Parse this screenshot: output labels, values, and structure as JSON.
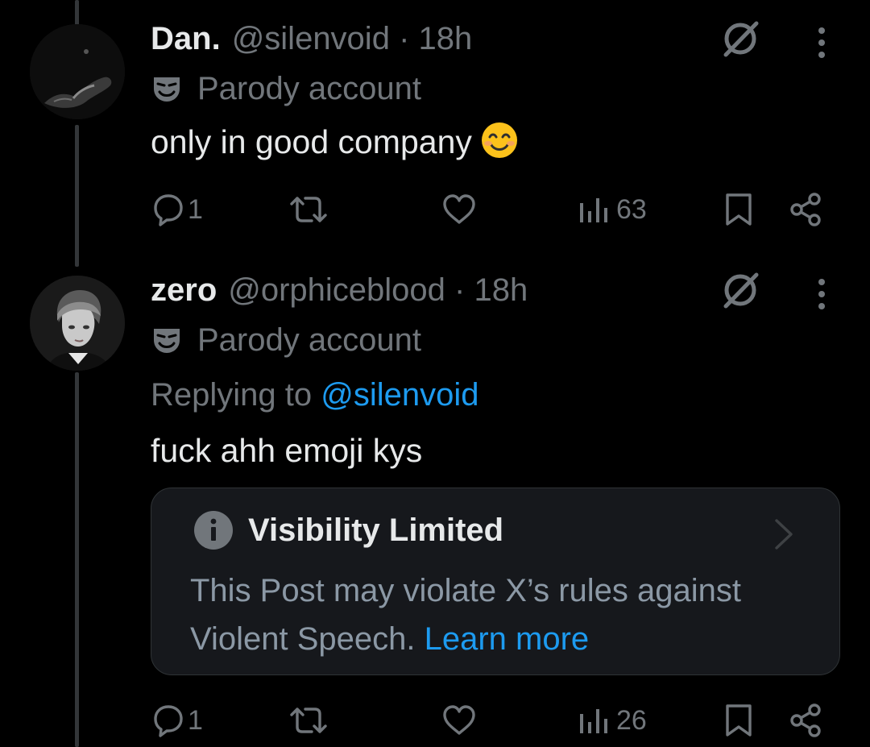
{
  "posts": [
    {
      "display_name": "Dan.",
      "handle": "@silenvoid",
      "time": "· 18h",
      "label": "Parody account",
      "text": "only in good company",
      "replies": "1",
      "views": "63"
    },
    {
      "display_name": "zero",
      "handle": "@orphiceblood",
      "time": "· 18h",
      "label": "Parody account",
      "replying_to_prefix": "Replying to",
      "replying_to_handle": "@silenvoid",
      "text": "fuck ahh emoji kys",
      "replies": "1",
      "views": "26",
      "notice": {
        "title": "Visibility Limited",
        "body": "This Post may violate X’s rules against Violent Speech.",
        "link": "Learn more"
      }
    }
  ],
  "colors": {
    "background": "#000000",
    "link": "#1d9bf0",
    "muted": "#71767b",
    "card": "#16181c"
  },
  "icons": [
    "grok-icon",
    "more-icon",
    "theater-mask-icon",
    "reply-icon",
    "repost-icon",
    "like-icon",
    "views-icon",
    "bookmark-icon",
    "share-icon",
    "info-icon",
    "chevron-right-icon",
    "smiling-face-emoji"
  ]
}
